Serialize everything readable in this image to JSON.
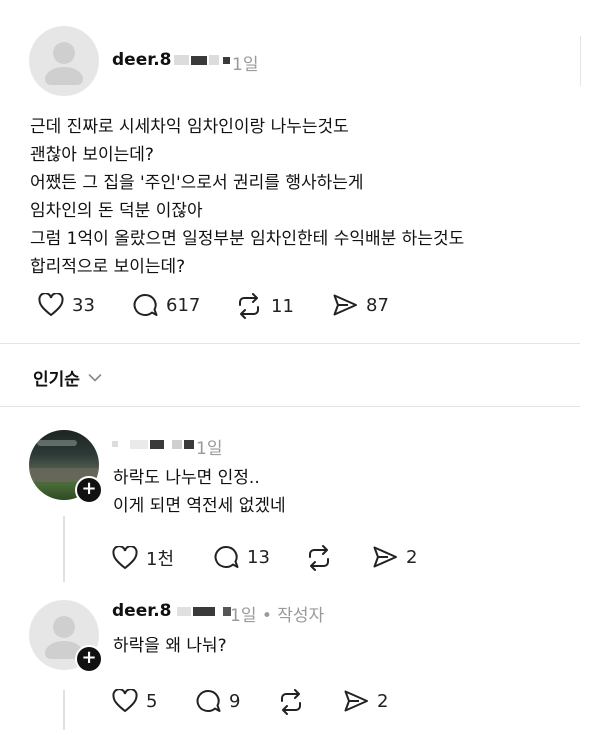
{
  "post": {
    "username": "deer.8",
    "time": "1일",
    "lines": [
      "근데 진짜로 시세차익 임차인이랑 나누는것도",
      "괜찮아 보이는데?",
      "어쨌든 그 집을 '주인'으로서 권리를 행사하는게",
      "임차인의 돈 덕분 이잖아",
      "그럼 1억이 올랐으면 일정부분 임차인한테 수익배분 하는것도",
      "합리적으로 보이는데?"
    ],
    "actions": {
      "likes": "33",
      "comments": "617",
      "reposts": "11",
      "shares": "87"
    }
  },
  "sort": {
    "label": "인기순"
  },
  "replies": [
    {
      "username": "",
      "time": "1일",
      "lines": [
        "하락도 나누면 인정..",
        "이게 되면 역전세 없겠네"
      ],
      "actions": {
        "likes": "1천",
        "comments": "13",
        "reposts": "",
        "shares": "2"
      }
    },
    {
      "username": "deer.8",
      "time": "1일 • 작성자",
      "lines": [
        "하락을 왜 나눠?"
      ],
      "actions": {
        "likes": "5",
        "comments": "9",
        "reposts": "",
        "shares": "2"
      }
    }
  ],
  "icons": [
    "heart-icon",
    "comment-icon",
    "repost-icon",
    "share-icon",
    "chevron-down-icon",
    "plus-icon",
    "user-avatar-icon"
  ]
}
